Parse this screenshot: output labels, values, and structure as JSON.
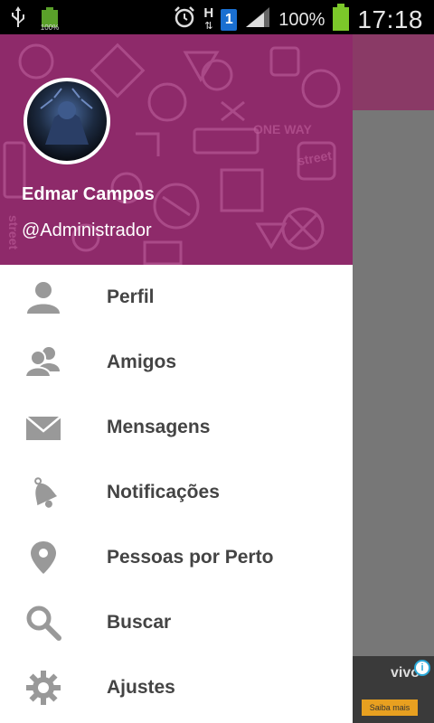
{
  "status_bar": {
    "battery_small": "100%",
    "network_type": "H",
    "sim_slot": "1",
    "battery_percent": "100%",
    "time": "17:18"
  },
  "drawer": {
    "user_name": "Edmar Campos",
    "user_handle": "@Administrador",
    "menu_items": [
      {
        "label": "Perfil",
        "icon": "person-icon"
      },
      {
        "label": "Amigos",
        "icon": "friends-icon"
      },
      {
        "label": "Mensagens",
        "icon": "envelope-icon"
      },
      {
        "label": "Notificações",
        "icon": "bell-icon"
      },
      {
        "label": "Pessoas por Perto",
        "icon": "location-pin-icon"
      },
      {
        "label": "Buscar",
        "icon": "search-icon"
      },
      {
        "label": "Ajustes",
        "icon": "gear-icon"
      }
    ]
  },
  "ad": {
    "brand": "vivo",
    "button": "Saiba mais"
  },
  "colors": {
    "header": "#8e2a6a",
    "menu_icon": "#999999",
    "menu_text": "#444444"
  }
}
